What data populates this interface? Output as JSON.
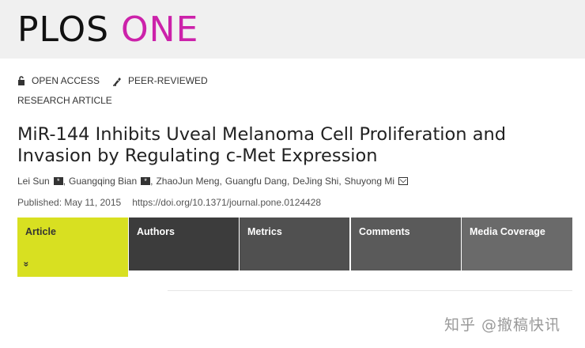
{
  "header": {
    "logo_part1": "PLOS",
    "logo_part2": "ONE"
  },
  "badges": {
    "open_access": "OPEN ACCESS",
    "peer_reviewed": "PEER-REVIEWED"
  },
  "article_type": "RESEARCH ARTICLE",
  "title": "MiR-144 Inhibits Uveal Melanoma Cell Proliferation and Invasion by Regulating c-Met Expression",
  "authors": [
    {
      "name": "Lei Sun",
      "badge": "*"
    },
    {
      "name": "Guangqing Bian",
      "badge": "*"
    },
    {
      "name": "ZhaoJun Meng"
    },
    {
      "name": "Guangfu Dang"
    },
    {
      "name": "DeJing Shi"
    },
    {
      "name": "Shuyong Mi",
      "mail": true
    }
  ],
  "publication": {
    "published": "Published: May 11, 2015",
    "doi": "https://doi.org/10.1371/journal.pone.0124428"
  },
  "tabs": [
    {
      "label": "Article"
    },
    {
      "label": "Authors"
    },
    {
      "label": "Metrics"
    },
    {
      "label": "Comments"
    },
    {
      "label": "Media Coverage"
    }
  ],
  "article_tab_chevron": "»",
  "watermark": "知乎 @撤稿快讯",
  "colors": {
    "logo_one": "#cc22aa",
    "active_tab": "#d8e021",
    "tab_dark": "#3c3c3c",
    "header_bg": "#f0f0f0"
  }
}
